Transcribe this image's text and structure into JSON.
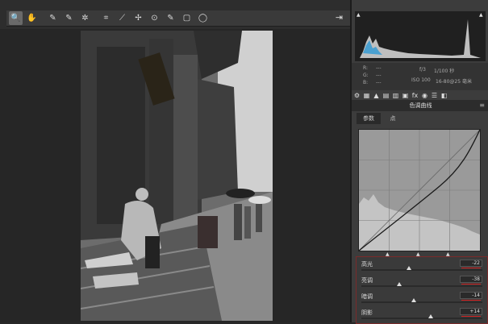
{
  "toolbar": {
    "tools": [
      {
        "name": "zoom-tool",
        "glyph": "🔍"
      },
      {
        "name": "hand-tool",
        "glyph": "✋"
      },
      {
        "name": "white-balance-tool",
        "glyph": "✎"
      },
      {
        "name": "color-sampler-tool",
        "glyph": "✎"
      },
      {
        "name": "targeted-adjustment-tool",
        "glyph": "✲"
      },
      {
        "name": "crop-tool",
        "glyph": "⌗"
      },
      {
        "name": "straighten-tool",
        "glyph": "⟋"
      },
      {
        "name": "spot-removal-tool",
        "glyph": "✢"
      },
      {
        "name": "red-eye-tool",
        "glyph": "⊙"
      },
      {
        "name": "adjustment-brush-tool",
        "glyph": "✎"
      },
      {
        "name": "graduated-filter-tool",
        "glyph": "▢"
      },
      {
        "name": "radial-filter-tool",
        "glyph": "◯"
      }
    ]
  },
  "info": {
    "r_label": "R:",
    "g_label": "G:",
    "b_label": "B:",
    "r_value": "---",
    "g_value": "---",
    "b_value": "---",
    "aperture": "f/3",
    "shutter": "1/100 秒",
    "iso": "ISO 100",
    "lens": "16-80@25 毫米"
  },
  "panel": {
    "title": "色调曲线",
    "tabs": [
      "参数",
      "点"
    ]
  },
  "sliders": [
    {
      "label": "高光",
      "value": "-22",
      "level": 0.39
    },
    {
      "label": "亮调",
      "value": "-38",
      "level": 0.31
    },
    {
      "label": "暗调",
      "value": "-14",
      "level": 0.43
    },
    {
      "label": "阴影",
      "value": "+14",
      "level": 0.57
    }
  ],
  "colors": {
    "accent": "#d02020",
    "panel_bg": "#3c3c3c",
    "curve_bg": "#9a9a9a"
  }
}
